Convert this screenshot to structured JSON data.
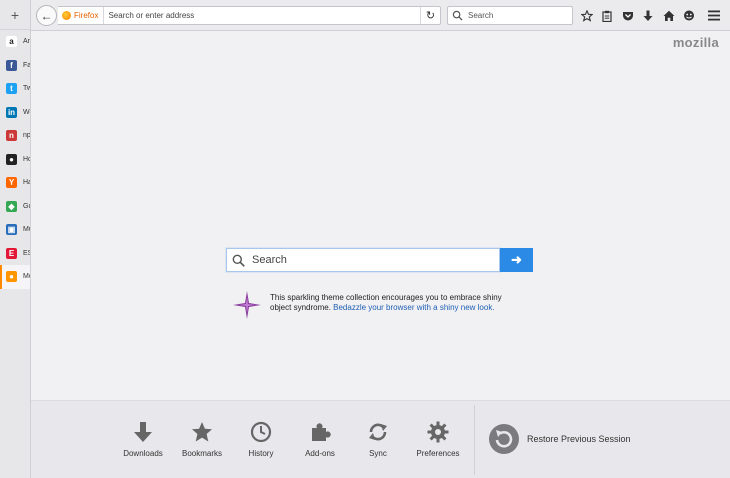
{
  "tabs": {
    "new_tab_glyph": "+",
    "items": [
      {
        "label": "Am",
        "icon": "amazon-icon",
        "letter": "a",
        "color": "#ffffff",
        "fg": "#222222"
      },
      {
        "label": "Fa",
        "icon": "facebook-icon",
        "letter": "f",
        "color": "#3b5998",
        "fg": "#ffffff"
      },
      {
        "label": "Tw",
        "icon": "twitter-icon",
        "letter": "t",
        "color": "#1da1f2",
        "fg": "#ffffff"
      },
      {
        "label": "We",
        "icon": "linkedin-icon",
        "letter": "in",
        "color": "#0077b5",
        "fg": "#ffffff"
      },
      {
        "label": "np",
        "icon": "npm-icon",
        "letter": "n",
        "color": "#cb3837",
        "fg": "#ffffff"
      },
      {
        "label": "Ho",
        "icon": "github-icon",
        "letter": "●",
        "color": "#222222",
        "fg": "#ffffff"
      },
      {
        "label": "Ha",
        "icon": "hacker-news-icon",
        "letter": "Y",
        "color": "#ff6600",
        "fg": "#ffffff"
      },
      {
        "label": "Go",
        "icon": "google-maps-icon",
        "letter": "◆",
        "color": "#34a853",
        "fg": "#ffffff"
      },
      {
        "label": "Mu",
        "icon": "music-icon",
        "letter": "▣",
        "color": "#2a6ebb",
        "fg": "#ffffff"
      },
      {
        "label": "ES",
        "icon": "espn-icon",
        "letter": "E",
        "color": "#e31837",
        "fg": "#ffffff"
      },
      {
        "label": "Mo",
        "icon": "firefox-icon",
        "letter": "●",
        "color": "#ff9500",
        "fg": "#ffffff",
        "active": true
      }
    ]
  },
  "navbar": {
    "back_glyph": "←",
    "identity_label": "Firefox",
    "url_placeholder": "Search or enter address",
    "reload_glyph": "↻",
    "search_placeholder": "Search"
  },
  "content": {
    "brand": "mozilla",
    "search_placeholder": "Search",
    "go_glyph": "➜",
    "snippet_text": "This sparkling theme collection encourages you to embrace shiny object syndrome. ",
    "snippet_link": "Bedazzle your browser with a shiny new look."
  },
  "launcher": {
    "downloads": "Downloads",
    "bookmarks": "Bookmarks",
    "history": "History",
    "addons": "Add-ons",
    "sync": "Sync",
    "preferences": "Preferences",
    "restore": "Restore Previous Session"
  },
  "colors": {
    "accent": "#2b8ae6",
    "link": "#1e5fb4",
    "active_tab": "#ff8a00"
  }
}
